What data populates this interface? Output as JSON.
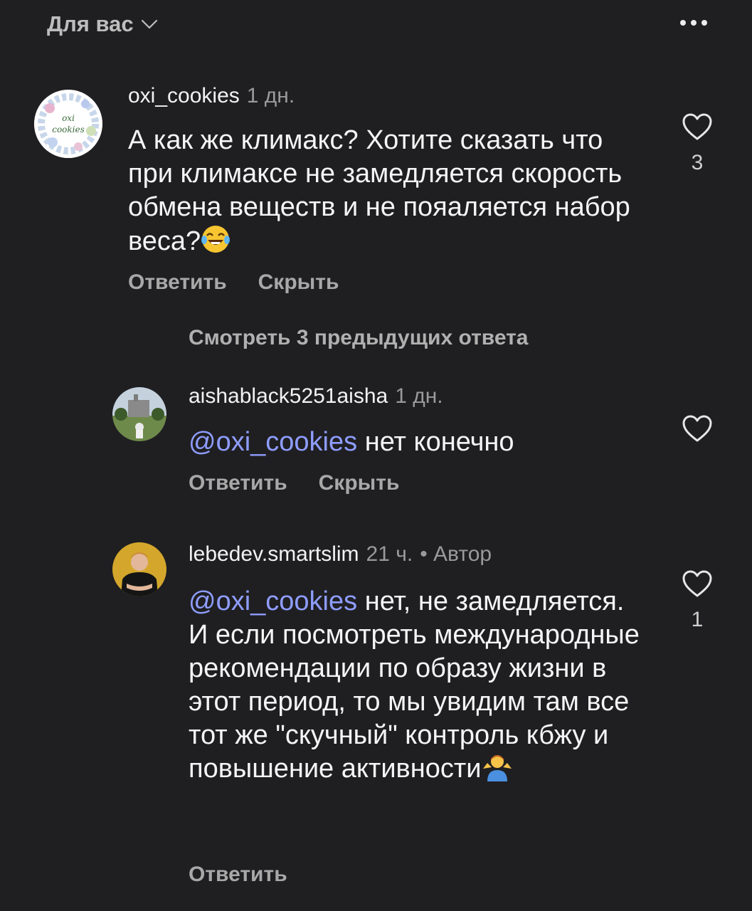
{
  "header": {
    "filter_label": "Для вас",
    "filter_icon": "chevron-down-icon",
    "more_icon": "more-dots-icon"
  },
  "comments": [
    {
      "username": "oxi_cookies",
      "time": "1 дн.",
      "text": "А как же климакс? Хотите сказать что  при климаксе не замедляется скорость обмена веществ и не пояаляется набор веса?",
      "emoji": "laughing-tears-emoji",
      "avatar_text": "oxi cookies",
      "like_count": "3",
      "reply_label": "Ответить",
      "hide_label": "Скрыть"
    }
  ],
  "view_previous": "Смотреть 3 предыдущих ответа",
  "replies": [
    {
      "username": "aishablack5251aisha",
      "time": "1 дн.",
      "mention": "@oxi_cookies",
      "text": "нет конечно",
      "reply_label": "Ответить",
      "hide_label": "Скрыть"
    },
    {
      "username": "lebedev.smartslim",
      "time": "21 ч.",
      "author_tag": "• Автор",
      "mention": "@oxi_cookies",
      "text": "нет, не замедляется. И если посмотреть международные рекомендации по образу жизни в этот период, то мы увидим там все тот же \"скучный\" контроль кбжу и повышение активности",
      "emoji": "person-shrugging-emoji",
      "like_count": "1",
      "reply_label": "Ответить"
    }
  ],
  "colors": {
    "background": "#1f1f22",
    "mention": "#8f9dff",
    "secondary_text": "#a8a8a8"
  }
}
